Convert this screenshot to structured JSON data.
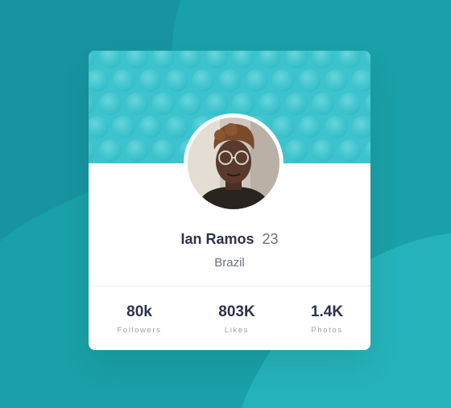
{
  "colors": {
    "background": "#1aa0a8",
    "background_shape_dark": "#1794a0",
    "background_shape_light": "#26b2ba",
    "header": "#3cc3cd",
    "card": "#ffffff",
    "name": "#2e3349",
    "muted": "#6b7082",
    "label": "#9a9ea8"
  },
  "profile": {
    "name": "Ian Ramos",
    "age": "23",
    "location": "Brazil",
    "avatar_icon": "user-photo"
  },
  "stats": [
    {
      "value": "80k",
      "label": "Followers"
    },
    {
      "value": "803K",
      "label": "Likes"
    },
    {
      "value": "1.4K",
      "label": "Photos"
    }
  ]
}
